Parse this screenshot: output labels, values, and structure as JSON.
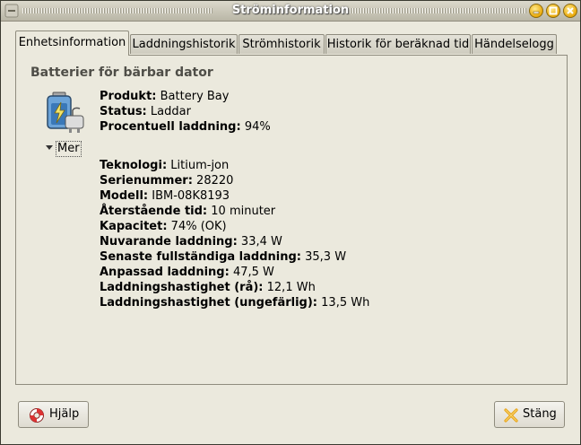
{
  "window": {
    "title": "Ströminformation"
  },
  "tabs": [
    {
      "label": "Enhetsinformation",
      "active": true
    },
    {
      "label": "Laddningshistorik"
    },
    {
      "label": "Strömhistorik"
    },
    {
      "label": "Historik för beräknad tid"
    },
    {
      "label": "Händelselogg"
    }
  ],
  "section": {
    "title": "Batterier för bärbar dator"
  },
  "summary": [
    {
      "label": "Produkt:",
      "value": "Battery Bay"
    },
    {
      "label": "Status:",
      "value": "Laddar"
    },
    {
      "label": "Procentuell laddning:",
      "value": "94%"
    }
  ],
  "expander": {
    "label": "Mer",
    "expanded": true
  },
  "details": [
    {
      "label": "Teknologi:",
      "value": "Litium-jon"
    },
    {
      "label": "Serienummer:",
      "value": "28220"
    },
    {
      "label": "Modell:",
      "value": "IBM-08K8193"
    },
    {
      "label": "Återstående tid:",
      "value": "10 minuter"
    },
    {
      "label": "Kapacitet:",
      "value": "74% (OK)"
    },
    {
      "label": "Nuvarande laddning:",
      "value": "33,4 W"
    },
    {
      "label": "Senaste fullständiga laddning:",
      "value": "35,3 W"
    },
    {
      "label": "Anpassad laddning:",
      "value": "47,5 W"
    },
    {
      "label": "Laddningshastighet (rå):",
      "value": "12,1 Wh"
    },
    {
      "label": "Laddningshastighet (ungefärlig):",
      "value": "13,5 Wh"
    }
  ],
  "buttons": {
    "help": "Hjälp",
    "close": "Stäng"
  },
  "icons": {
    "help": "lifebuoy-icon",
    "close": "close-x-icon",
    "battery": "battery-charging-icon"
  },
  "colors": {
    "accent_gold": "#e9a90a",
    "close_x": "#e8a317"
  }
}
